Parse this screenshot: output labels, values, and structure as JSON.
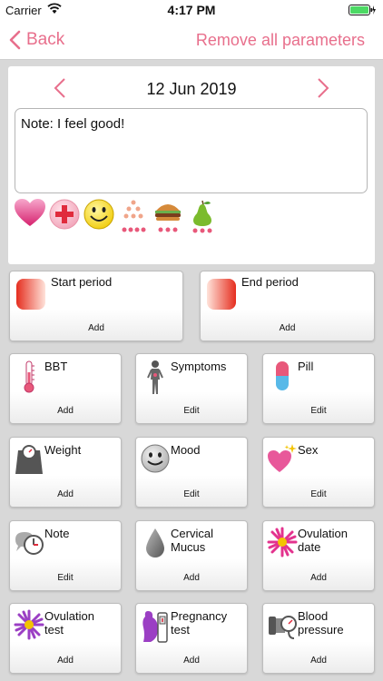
{
  "status_bar": {
    "carrier": "Carrier",
    "time": "4:17 PM"
  },
  "nav": {
    "back_label": "Back",
    "remove_all_label": "Remove all parameters"
  },
  "date": "12 Jun 2019",
  "note": {
    "value": "Note: I feel good!"
  },
  "quick_icons": [
    "heart-icon",
    "first-aid-icon",
    "smiley-icon",
    "dots-icon",
    "burger-icon",
    "pear-icon"
  ],
  "period": [
    {
      "label": "Start period",
      "action": "Add"
    },
    {
      "label": "End period",
      "action": "Add"
    }
  ],
  "parameters": [
    {
      "label": "BBT",
      "action": "Add",
      "icon": "thermometer-icon"
    },
    {
      "label": "Symptoms",
      "action": "Edit",
      "icon": "body-icon"
    },
    {
      "label": "Pill",
      "action": "Edit",
      "icon": "pill-icon"
    },
    {
      "label": "Weight",
      "action": "Add",
      "icon": "scale-icon"
    },
    {
      "label": "Mood",
      "action": "Edit",
      "icon": "mood-face-icon"
    },
    {
      "label": "Sex",
      "action": "Edit",
      "icon": "sparkle-heart-icon"
    },
    {
      "label": "Note",
      "action": "Edit",
      "icon": "note-clock-icon"
    },
    {
      "label": "Cervical\nMucus",
      "action": "Add",
      "icon": "drop-icon"
    },
    {
      "label": "Ovulation\ndate",
      "action": "Add",
      "icon": "pink-flower-icon"
    },
    {
      "label": "Ovulation\ntest",
      "action": "Add",
      "icon": "purple-flower-icon"
    },
    {
      "label": "Pregnancy\ntest",
      "action": "Add",
      "icon": "pregnancy-test-icon"
    },
    {
      "label": "Blood\npressure",
      "action": "Add",
      "icon": "blood-pressure-icon"
    }
  ],
  "colors": {
    "accent": "#e86f8c",
    "background": "#d8d8d8"
  }
}
